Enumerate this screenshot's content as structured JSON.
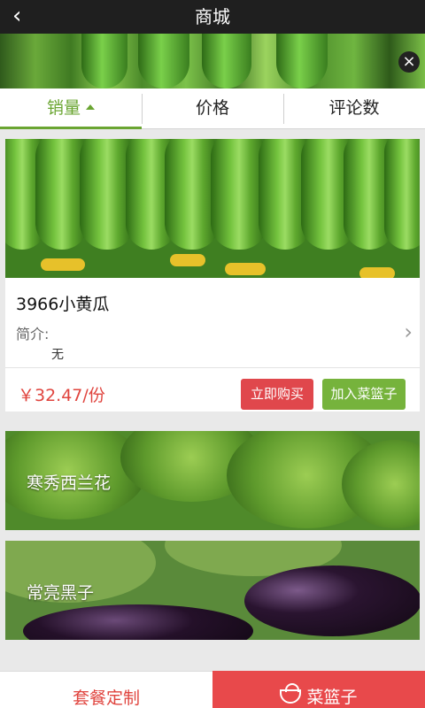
{
  "header": {
    "back_icon": "back-arrow-icon",
    "title": "商城"
  },
  "banner": {
    "close_glyph": "×"
  },
  "tabs": [
    {
      "label": "销量",
      "active": true,
      "sort_icon": "caret-up-icon"
    },
    {
      "label": "价格",
      "active": false
    },
    {
      "label": "评论数",
      "active": false
    }
  ],
  "product": {
    "name": "3966小黄瓜",
    "intro_label": "简介:",
    "intro_text": "无",
    "price": "￥32.47/份",
    "buy_label": "立即购买",
    "cart_label": "加入菜篮子"
  },
  "items": [
    {
      "label": "寒秀西兰花"
    },
    {
      "label": "常亮黑子"
    }
  ],
  "bottom": {
    "left_label": "套餐定制",
    "right_label": "菜篮子",
    "right_icon": "basket-icon"
  },
  "colors": {
    "accent_green": "#6aa531",
    "price_red": "#e0443e",
    "buy_red": "#e0474c",
    "cart_green": "#76b33c",
    "topbar": "#1f1f1f"
  }
}
